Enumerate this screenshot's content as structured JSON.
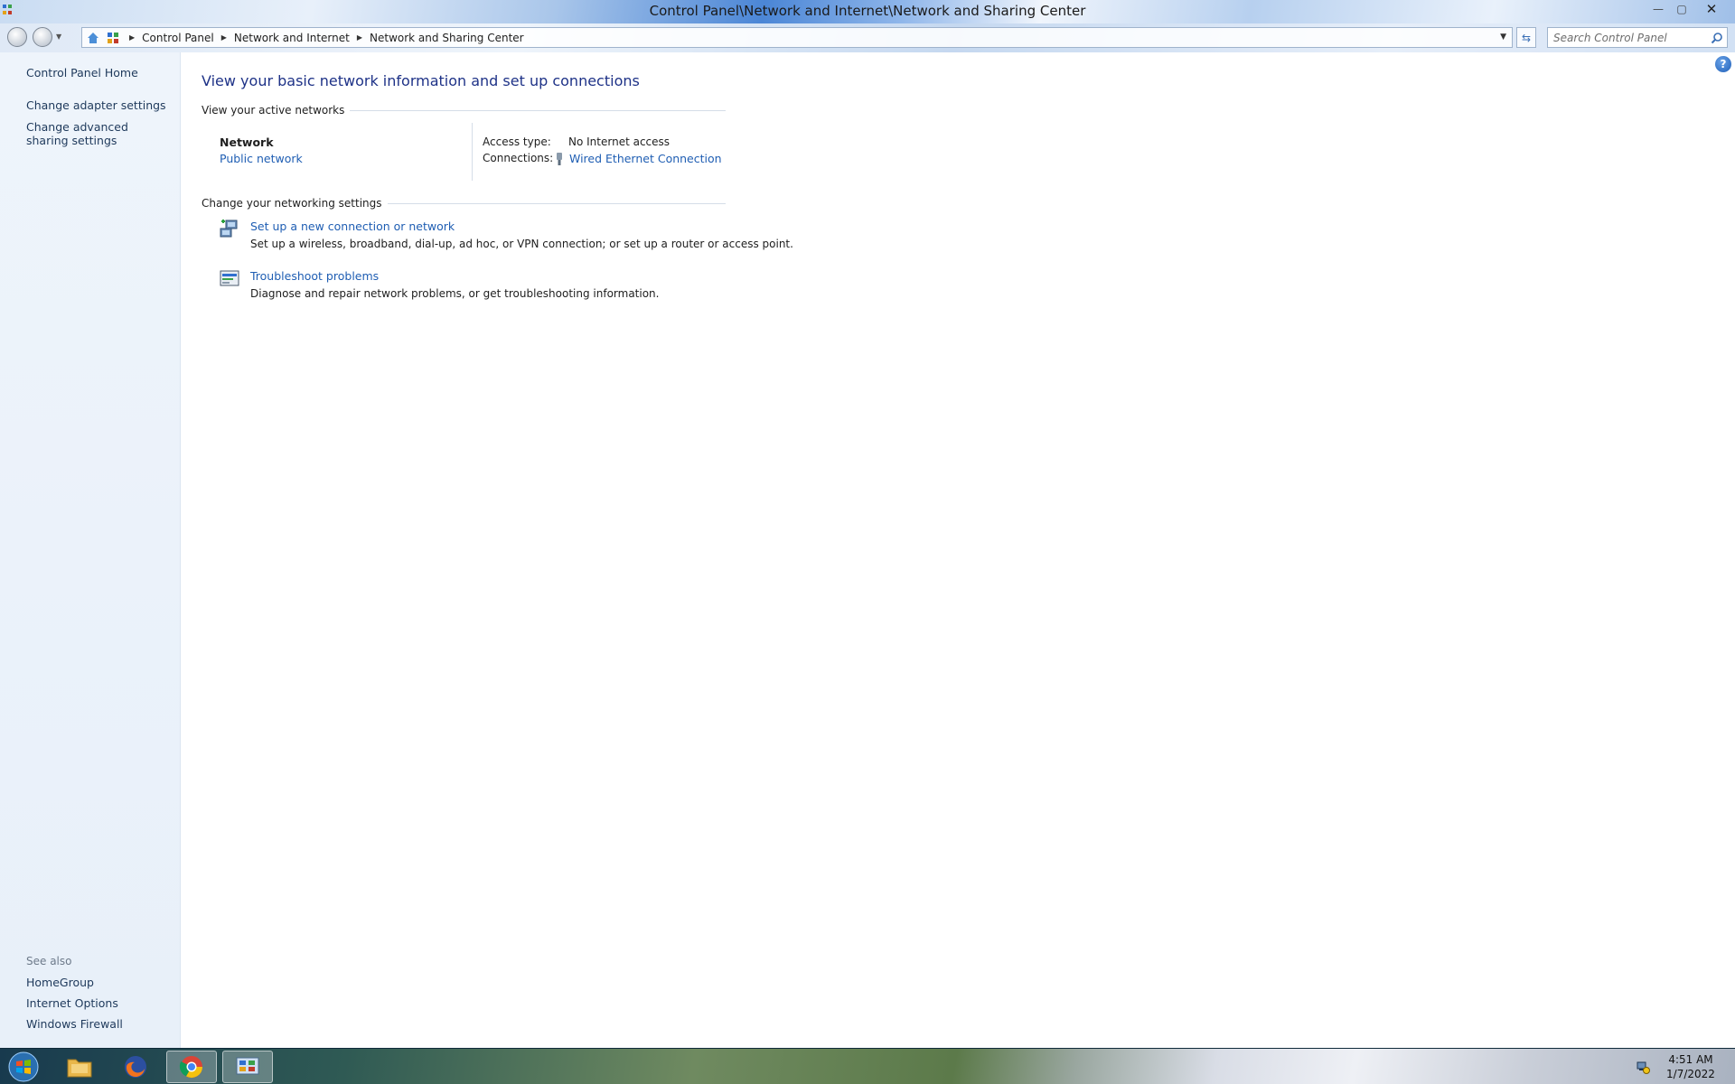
{
  "window": {
    "title": "Control Panel\\Network and Internet\\Network and Sharing Center",
    "controls": {
      "minimize": "—",
      "maximize": "▢",
      "close": "✕"
    }
  },
  "address_bar": {
    "breadcrumbs": [
      "Control Panel",
      "Network and Internet",
      "Network and Sharing Center"
    ],
    "search_placeholder": "Search Control Panel"
  },
  "sidebar": {
    "home_link": "Control Panel Home",
    "links": [
      "Change adapter settings",
      "Change advanced sharing settings"
    ],
    "see_also_label": "See also",
    "see_also_links": [
      "HomeGroup",
      "Internet Options",
      "Windows Firewall"
    ]
  },
  "main": {
    "heading": "View your basic network information and set up connections",
    "active_networks_label": "View your active networks",
    "network": {
      "name": "Network",
      "type": "Public network",
      "access_type_label": "Access type:",
      "access_type_value": "No Internet access",
      "connections_label": "Connections:",
      "connection_value": "Wired Ethernet Connection"
    },
    "settings_label": "Change your networking settings",
    "tasks": [
      {
        "title": "Set up a new connection or network",
        "description": "Set up a wireless, broadband, dial-up, ad hoc, or VPN connection; or set up a router or access point."
      },
      {
        "title": "Troubleshoot problems",
        "description": "Diagnose and repair network problems, or get troubleshooting information."
      }
    ]
  },
  "taskbar": {
    "apps": [
      "start",
      "file-explorer",
      "firefox",
      "chrome",
      "control-panel"
    ],
    "clock_time": "4:51 AM",
    "clock_date": "1/7/2022"
  },
  "colors": {
    "link": "#1f5eb3",
    "heading": "#1e3287",
    "sidebar_bg": "#eef4fb"
  }
}
